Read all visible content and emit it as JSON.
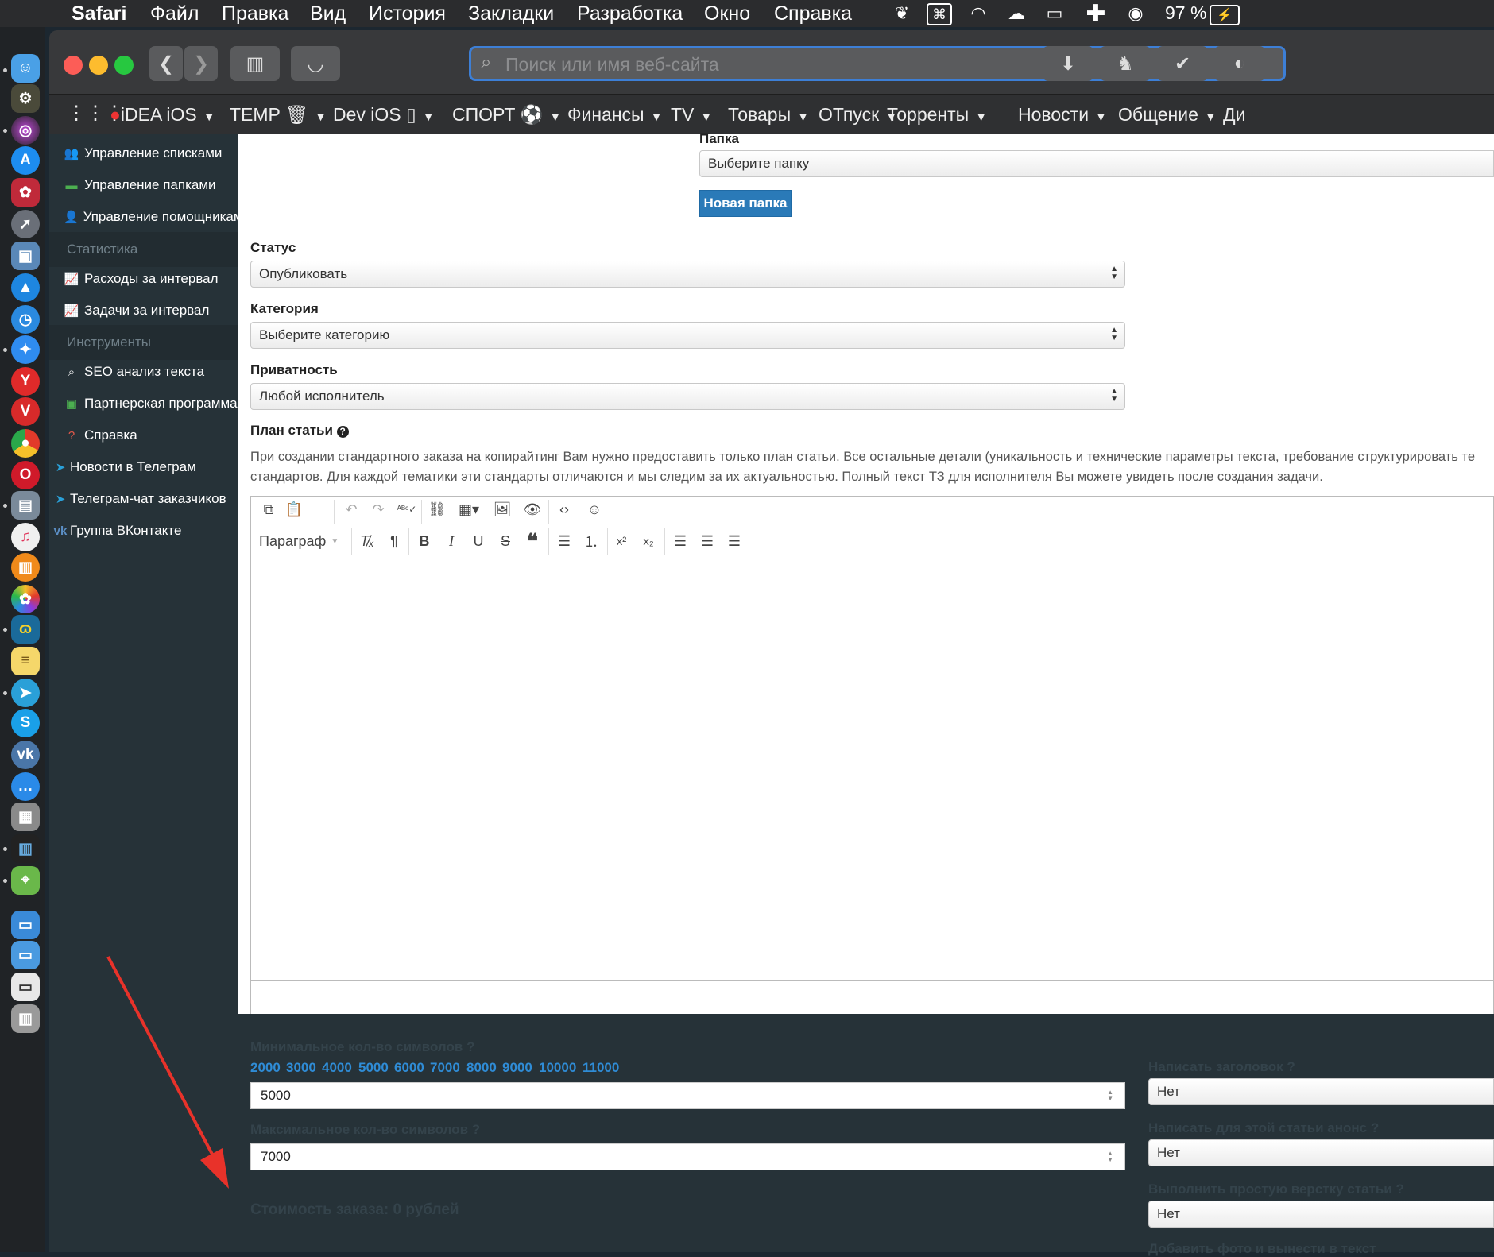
{
  "menubar": {
    "app": "Safari",
    "items": [
      "Файл",
      "Правка",
      "Вид",
      "История",
      "Закладки",
      "Разработка",
      "Окно",
      "Справка"
    ],
    "battery": "97 %"
  },
  "toolbar": {
    "search_placeholder": "Поиск или имя веб-сайта"
  },
  "bookmarks": {
    "items": [
      "iDEA iOS",
      "TEMP",
      "Dev iOS",
      "СПОРТ",
      "Финансы",
      "TV",
      "Товары",
      "ОТпуск",
      "Торренты",
      "Новости",
      "Общение",
      "Ди"
    ]
  },
  "sidebar": {
    "items": [
      {
        "label": "Управление списками",
        "icon": "users-icon"
      },
      {
        "label": "Управление папками",
        "icon": "folder-icon"
      },
      {
        "label": "Управление помощниками",
        "icon": "user-plus-icon"
      }
    ],
    "section_stats": "Статистика",
    "stats_items": [
      {
        "label": "Расходы за интервал",
        "icon": "line-chart-icon"
      },
      {
        "label": "Задачи за интервал",
        "icon": "line-chart-icon"
      }
    ],
    "section_tools": "Инструменты",
    "tools_items": [
      {
        "label": "SEO анализ текста",
        "icon": "search-icon"
      },
      {
        "label": "Партнерская программа",
        "icon": "money-icon"
      },
      {
        "label": "Справка",
        "icon": "question-icon"
      },
      {
        "label": "Новости в Телеграм",
        "icon": "telegram-icon"
      },
      {
        "label": "Телеграм-чат заказчиков",
        "icon": "telegram-icon"
      },
      {
        "label": "Группа ВКонтакте",
        "icon": "vk-icon"
      }
    ]
  },
  "form": {
    "folder_label": "Папка",
    "folder_value": "Выберите папку",
    "new_folder_button": "Новая папка",
    "status_label": "Статус",
    "status_value": "Опубликовать",
    "category_label": "Категория",
    "category_value": "Выберите категорию",
    "privacy_label": "Приватность",
    "privacy_value": "Любой исполнитель",
    "plan_label": "План статьи",
    "plan_desc_1": "При создании стандартного заказа на копирайтинг Вам нужно предоставить только план статьи. Все остальные детали (уникальность и технические параметры текста, требование структурировать те",
    "plan_desc_2": "стандартов. Для каждой тематики эти стандарты отличаются и мы следим за их актуальностью. Полный текст ТЗ для исполнителя Вы можете увидеть после создания задачи.",
    "editor_format": "Параграф",
    "min_chars_label": "Минимальное кол-во символов",
    "presets": [
      "2000",
      "3000",
      "4000",
      "5000",
      "6000",
      "7000",
      "8000",
      "9000",
      "10000",
      "11000"
    ],
    "min_chars_value": "5000",
    "max_chars_label": "Максимальное кол-во символов",
    "max_chars_value": "7000",
    "cost": "Стоимость заказа: 0 рублей",
    "write_title_label": "Написать заголовок",
    "write_title_value": "Нет",
    "write_anons_label": "Написать для этой статьи анонс",
    "write_anons_value": "Нет",
    "layout_label": "Выполнить простую верстку статьи",
    "layout_value": "Нет",
    "extra_label": "Добавить фото и вынести в текст"
  },
  "colors": {
    "sidebar_bg": "#263238",
    "accent": "#2a7ab8",
    "link": "#2f8cd6",
    "arrow": "#e8322a"
  }
}
